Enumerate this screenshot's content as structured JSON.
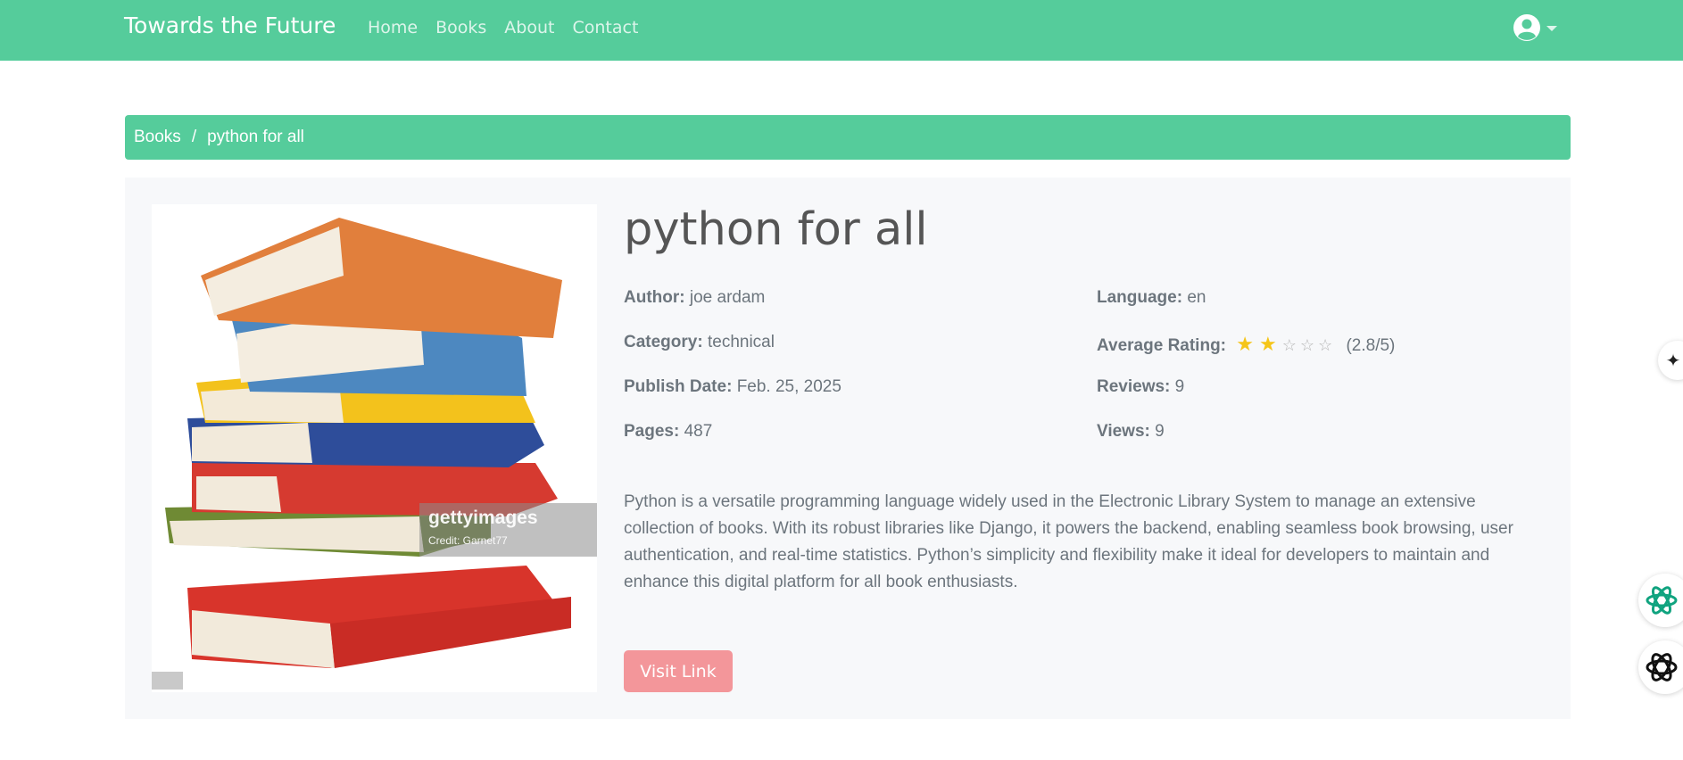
{
  "navbar": {
    "brand": "Towards the Future",
    "links": [
      "Home",
      "Books",
      "About",
      "Contact"
    ],
    "user_icon": "user-circle-icon",
    "bg_color": "#55cc9b"
  },
  "breadcrumb": {
    "root": "Books",
    "separator": "/",
    "current": "python for all"
  },
  "book": {
    "cover_icon": "book-stack-cover-image",
    "cover_watermark": "gettyimages",
    "cover_credit": "Credit: Garnet77",
    "title": "python for all",
    "fields": {
      "author_label": "Author:",
      "author": "joe ardam",
      "category_label": "Category:",
      "category": "technical",
      "publish_label": "Publish Date:",
      "publish_date": "Feb. 25, 2025",
      "pages_label": "Pages:",
      "pages": "487",
      "language_label": "Language:",
      "language": "en",
      "rating_label": "Average Rating:",
      "rating_value": 2.8,
      "rating_max": 5,
      "rating_text": "(2.8/5)",
      "reviews_label": "Reviews:",
      "reviews": "9",
      "views_label": "Views:",
      "views": "9"
    },
    "description": "Python is a versatile programming language widely used in the Electronic Library System to manage an extensive collection of books. With its robust libraries like Django, it powers the backend, enabling seamless book browsing, user authentication, and real-time statistics. Python’s simplicity and flexibility make it ideal for developers to maintain and enhance this digital platform for all book enthusiasts.",
    "visit_label": "Visit Link",
    "visit_color": "#f3969a"
  },
  "floating": [
    "sparkle-icon",
    "chatgpt-icon",
    "openai-icon"
  ]
}
